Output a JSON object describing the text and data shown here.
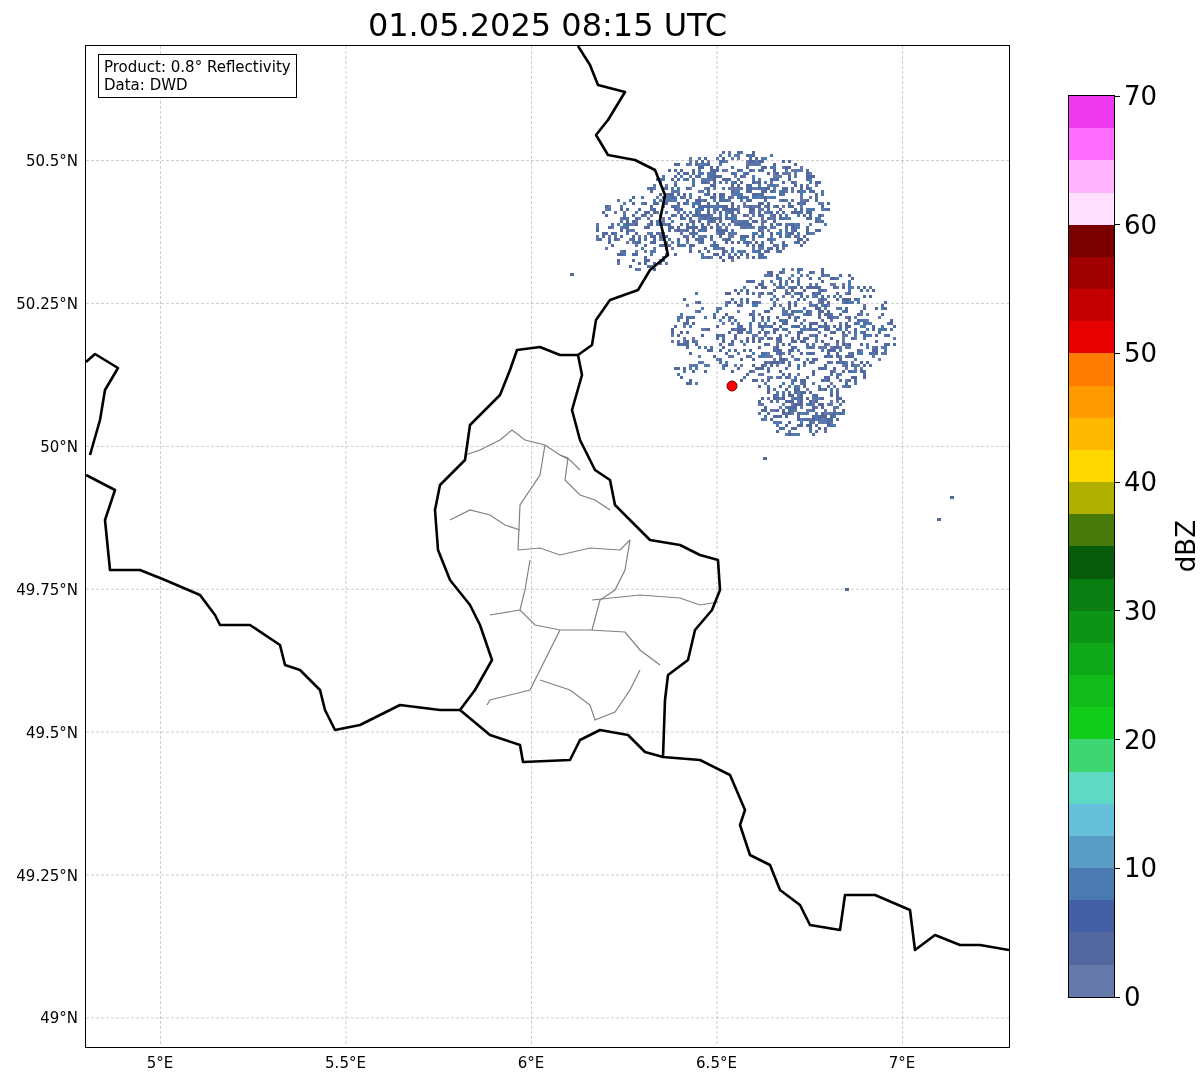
{
  "title": "01.05.2025 08:15 UTC",
  "map": {
    "info_box": [
      "Product: 0.8° Reflectivity",
      "Data: DWD"
    ],
    "lat_ticks": [
      "50.5°N",
      "50.25°N",
      "50°N",
      "49.75°N",
      "49.5°N",
      "49.25°N",
      "49°N"
    ],
    "lon_ticks": [
      "5°E",
      "5.5°E",
      "6°E",
      "6.5°E",
      "7°E"
    ]
  },
  "colorbar": {
    "label": "dBZ",
    "ticks": [
      "70",
      "60",
      "50",
      "40",
      "30",
      "20",
      "10",
      "0"
    ],
    "bands": [
      {
        "color": "#ee3aee"
      },
      {
        "color": "#ff6cff"
      },
      {
        "color": "#ffb4ff"
      },
      {
        "color": "#ffe0ff"
      },
      {
        "color": "#7a0000"
      },
      {
        "color": "#a00000"
      },
      {
        "color": "#c40000"
      },
      {
        "color": "#e60000"
      },
      {
        "color": "#ff7c00"
      },
      {
        "color": "#ff9a00"
      },
      {
        "color": "#ffb800"
      },
      {
        "color": "#ffd800"
      },
      {
        "color": "#b0b000"
      },
      {
        "color": "#477a0a"
      },
      {
        "color": "#065c0a"
      },
      {
        "color": "#0a7e12"
      },
      {
        "color": "#0c9416"
      },
      {
        "color": "#0ea818"
      },
      {
        "color": "#10bb1a"
      },
      {
        "color": "#12cc1a"
      },
      {
        "color": "#3dd672"
      },
      {
        "color": "#5fd8c4"
      },
      {
        "color": "#66c0da"
      },
      {
        "color": "#5a9ec5"
      },
      {
        "color": "#4a7ab0"
      },
      {
        "color": "#4460a4"
      },
      {
        "color": "#5468a0"
      },
      {
        "color": "#6677aa"
      }
    ]
  }
}
